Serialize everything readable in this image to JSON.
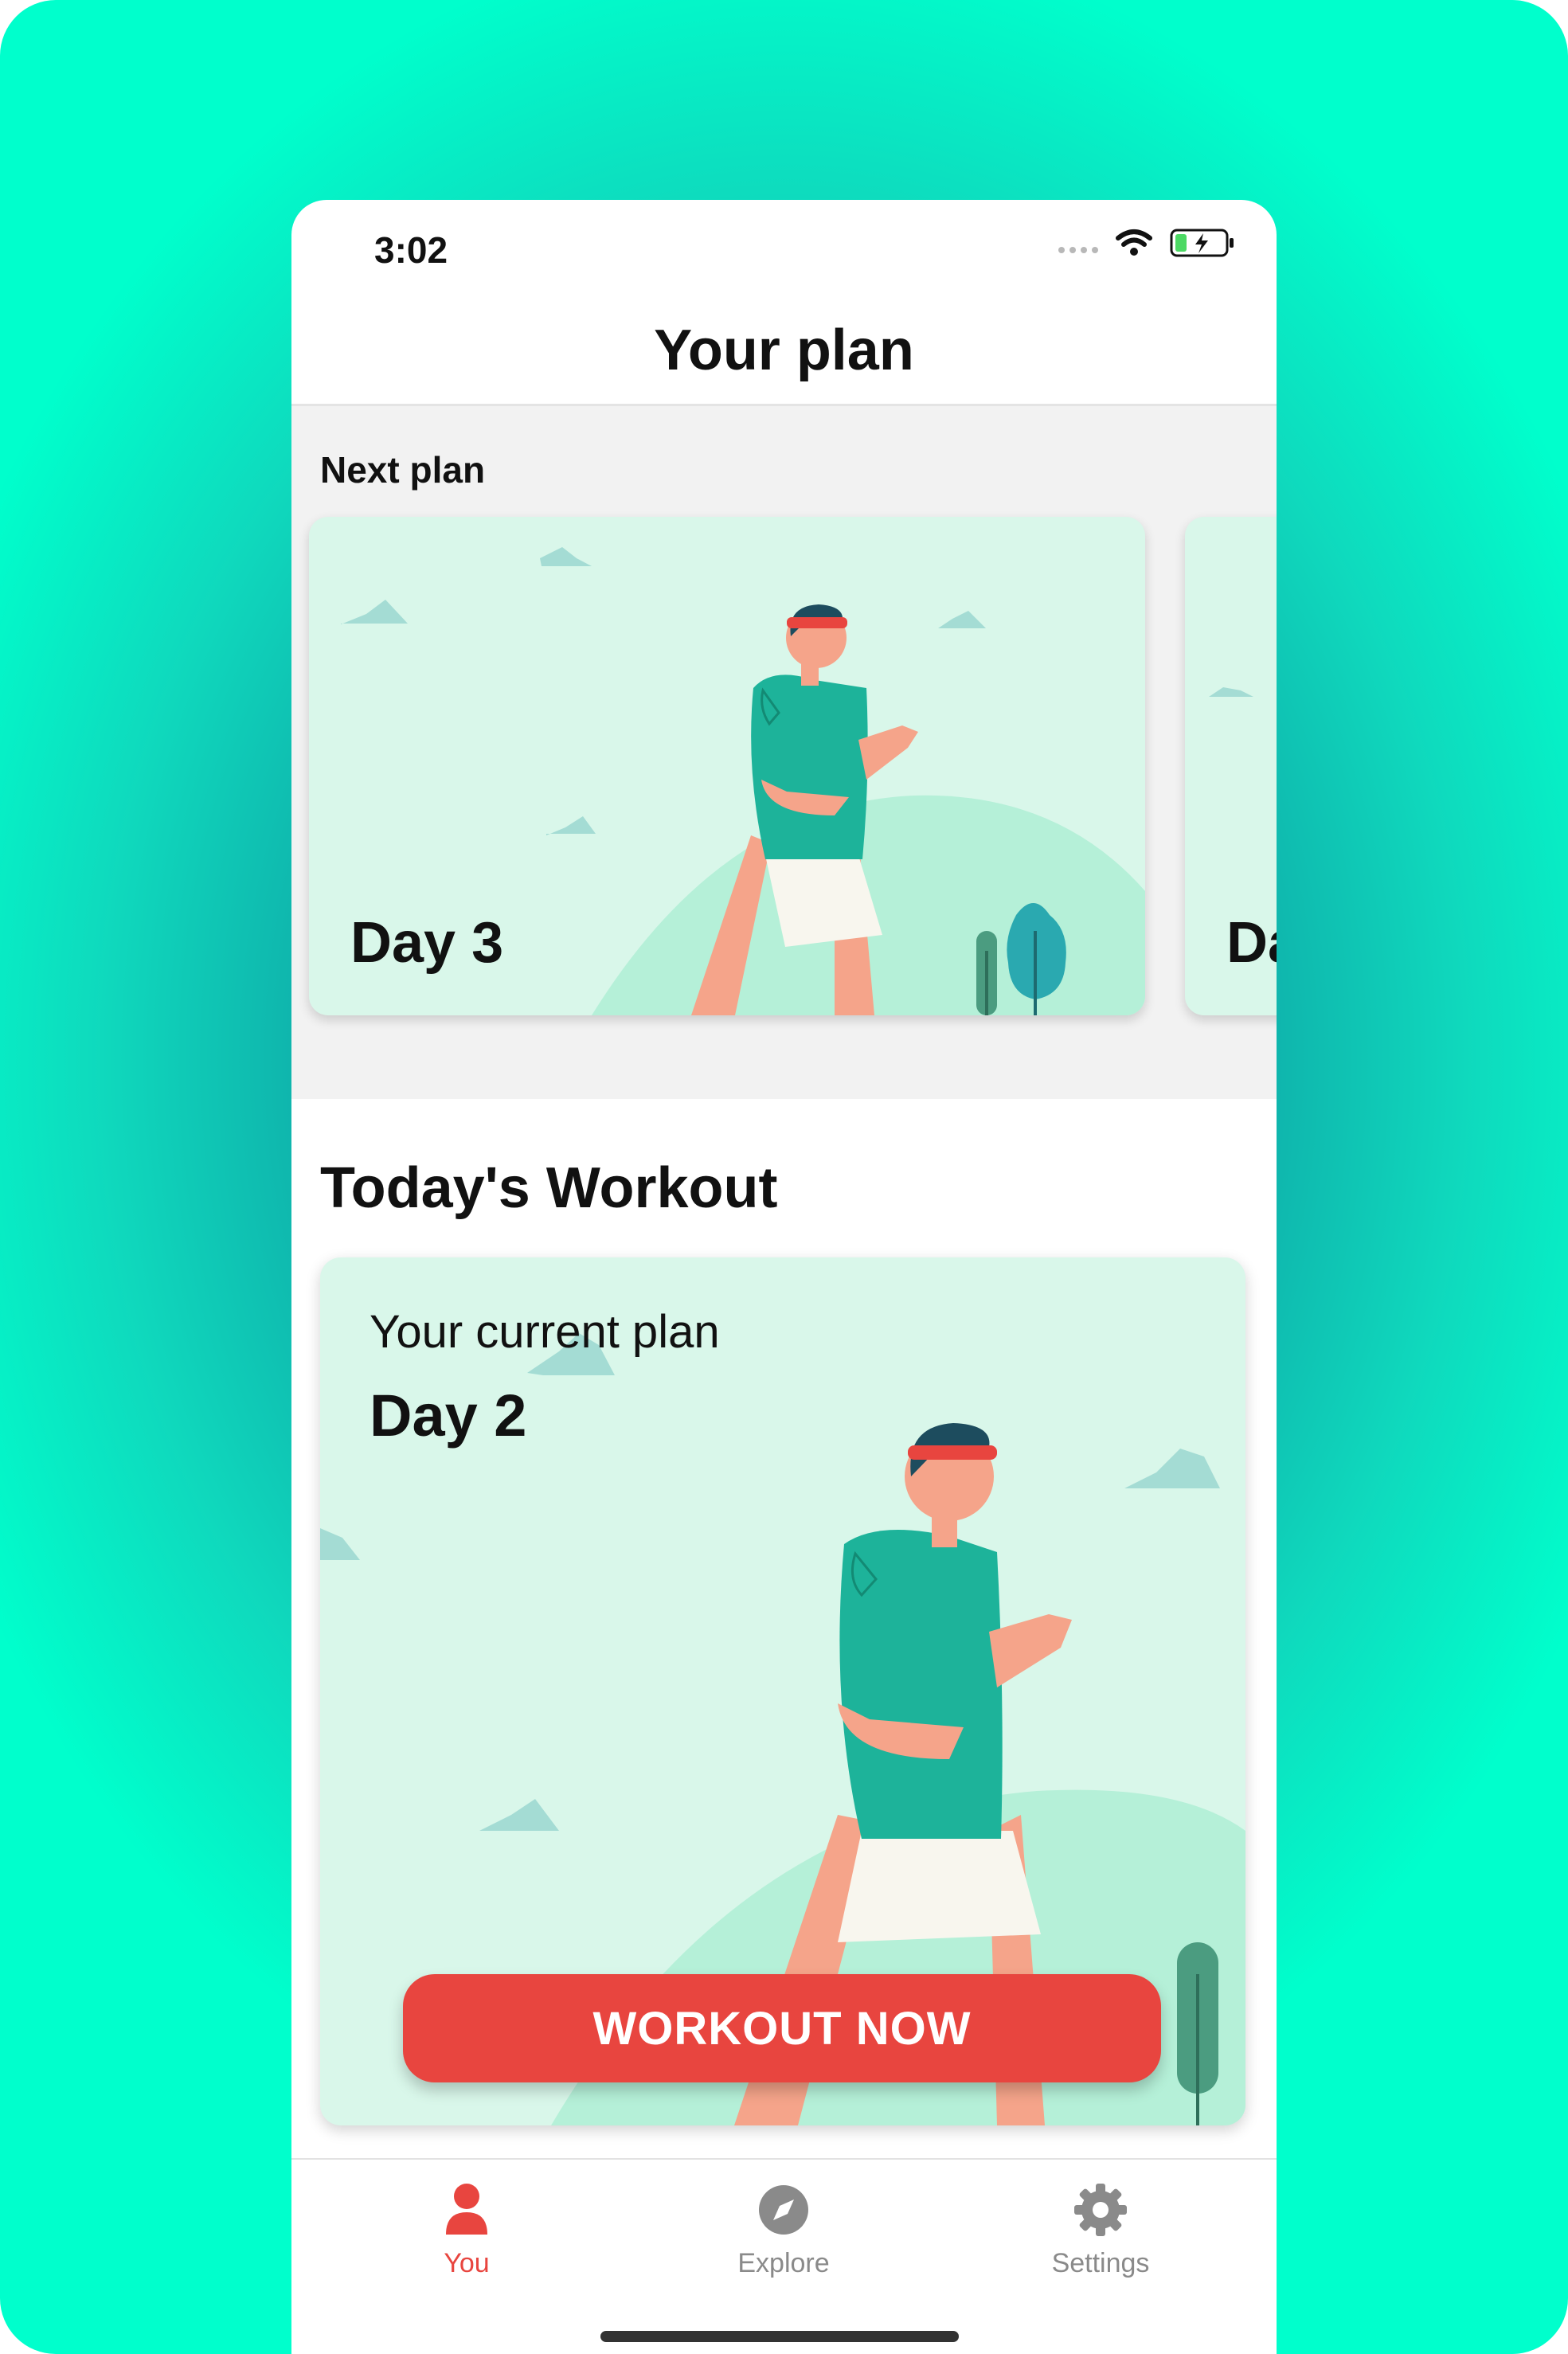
{
  "status_bar": {
    "time": "3:02"
  },
  "header": {
    "title": "Your plan"
  },
  "next_plan": {
    "label": "Next plan",
    "cards": [
      {
        "day": "Day 3"
      },
      {
        "day": "Da"
      }
    ]
  },
  "today": {
    "title": "Today's Workout",
    "card": {
      "subtitle": "Your current plan",
      "day": "Day 2",
      "button_label": "WORKOUT NOW"
    }
  },
  "tabs": [
    {
      "label": "You",
      "icon": "person-icon",
      "active": true
    },
    {
      "label": "Explore",
      "icon": "compass-icon",
      "active": false
    },
    {
      "label": "Settings",
      "icon": "gear-icon",
      "active": false
    }
  ],
  "colors": {
    "accent": "#e8453f",
    "card_bg": "#d9f7ea",
    "shirt": "#1db39a",
    "inactive_tab": "#8a8a8a"
  }
}
